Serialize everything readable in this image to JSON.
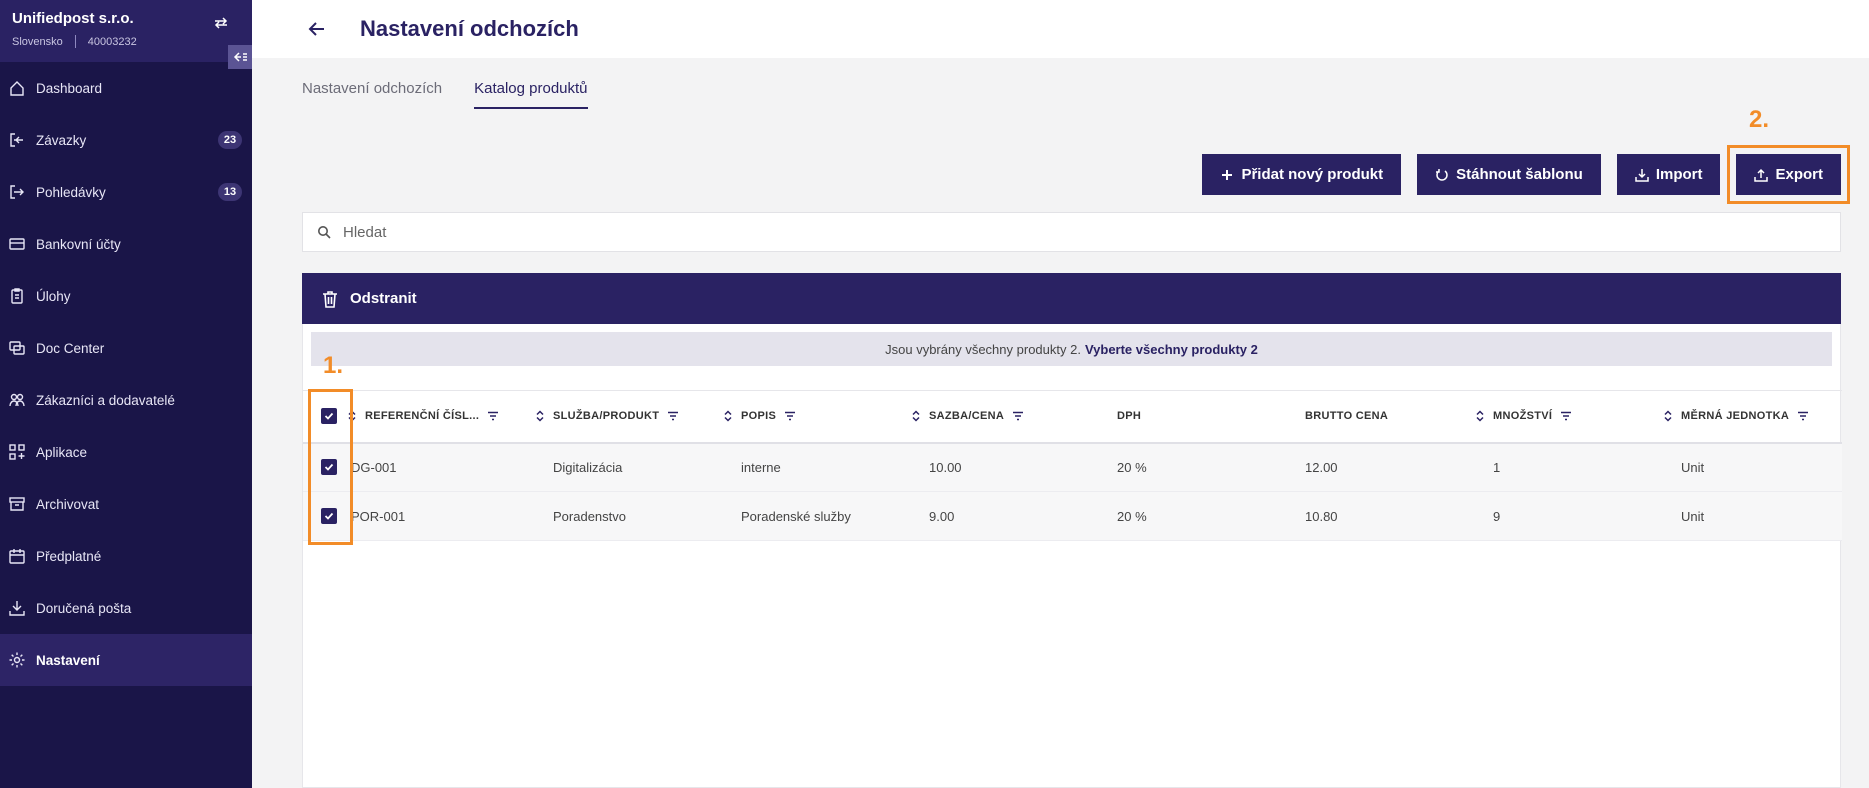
{
  "org": {
    "name": "Unifiedpost s.r.o.",
    "country": "Slovensko",
    "id": "40003232"
  },
  "sidebar": {
    "items": [
      {
        "label": "Dashboard",
        "icon": "home-icon",
        "badge": null
      },
      {
        "label": "Závazky",
        "icon": "inbox-in-icon",
        "badge": "23"
      },
      {
        "label": "Pohledávky",
        "icon": "inbox-out-icon",
        "badge": "13"
      },
      {
        "label": "Bankovní účty",
        "icon": "card-icon",
        "badge": null
      },
      {
        "label": "Úlohy",
        "icon": "clipboard-icon",
        "badge": null
      },
      {
        "label": "Doc Center",
        "icon": "doc-center-icon",
        "badge": null
      },
      {
        "label": "Zákazníci a dodavatelé",
        "icon": "people-icon",
        "badge": null
      },
      {
        "label": "Aplikace",
        "icon": "apps-icon",
        "badge": null
      },
      {
        "label": "Archivovat",
        "icon": "archive-icon",
        "badge": null
      },
      {
        "label": "Předplatné",
        "icon": "calendar-icon",
        "badge": null
      },
      {
        "label": "Doručená pošta",
        "icon": "download-icon",
        "badge": null
      },
      {
        "label": "Nastavení",
        "icon": "gear-icon",
        "badge": null
      }
    ]
  },
  "header": {
    "title": "Nastavení odchozích"
  },
  "tabs": [
    {
      "label": "Nastavení odchozích"
    },
    {
      "label": "Katalog produktů"
    }
  ],
  "toolbar": {
    "add": "Přidat nový produkt",
    "template": "Stáhnout šablonu",
    "import": "Import",
    "export": "Export"
  },
  "search": {
    "placeholder": "Hledat"
  },
  "actionbar": {
    "delete": "Odstranit"
  },
  "notice": {
    "text": "Jsou vybrány všechny produkty 2.",
    "link": "Vyberte všechny produkty 2"
  },
  "annotations": {
    "one": "1.",
    "two": "2."
  },
  "table": {
    "columns": [
      {
        "label": "REFERENČNÍ ČÍSL...",
        "sortable": true,
        "filter": true
      },
      {
        "label": "SLUŽBA/PRODUKT",
        "sortable": true,
        "filter": true
      },
      {
        "label": "POPIS",
        "sortable": true,
        "filter": true
      },
      {
        "label": "SAZBA/CENA",
        "sortable": true,
        "filter": true
      },
      {
        "label": "DPH",
        "sortable": false,
        "filter": false
      },
      {
        "label": "BRUTTO CENA",
        "sortable": false,
        "filter": false
      },
      {
        "label": "MNOŽSTVÍ",
        "sortable": true,
        "filter": true
      },
      {
        "label": "MĚRNÁ JEDNOTKA",
        "sortable": true,
        "filter": true
      }
    ],
    "rows": [
      [
        "DG-001",
        "Digitalizácia",
        "interne",
        "10.00",
        "20 %",
        "12.00",
        "1",
        "Unit"
      ],
      [
        "POR-001",
        "Poradenstvo",
        "Poradenské služby",
        "9.00",
        "20 %",
        "10.80",
        "9",
        "Unit"
      ]
    ]
  },
  "colors": {
    "primary": "#2a2263",
    "sidebar": "#1a1548",
    "annotation": "#f28c28"
  }
}
